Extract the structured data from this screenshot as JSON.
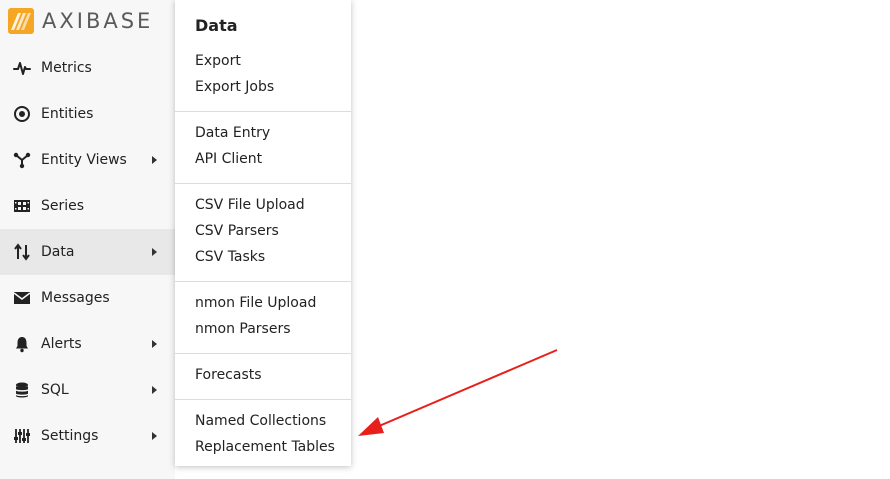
{
  "app": {
    "brand": "AXIBASE",
    "brand_colors": [
      "#f5a623",
      "#e8771e"
    ]
  },
  "sidebar": {
    "items": [
      {
        "label": "Metrics",
        "icon": "pulse-icon",
        "has_submenu": false
      },
      {
        "label": "Entities",
        "icon": "target-icon",
        "has_submenu": false
      },
      {
        "label": "Entity Views",
        "icon": "share-nodes-icon",
        "has_submenu": true
      },
      {
        "label": "Series",
        "icon": "film-strip-icon",
        "has_submenu": false
      },
      {
        "label": "Data",
        "icon": "sort-arrows-icon",
        "has_submenu": true,
        "active": true
      },
      {
        "label": "Messages",
        "icon": "envelope-icon",
        "has_submenu": false
      },
      {
        "label": "Alerts",
        "icon": "bell-icon",
        "has_submenu": true
      },
      {
        "label": "SQL",
        "icon": "database-icon",
        "has_submenu": true
      },
      {
        "label": "Settings",
        "icon": "sliders-icon",
        "has_submenu": true
      }
    ]
  },
  "menu": {
    "title": "Data",
    "groups": [
      [
        "Export",
        "Export Jobs"
      ],
      [
        "Data Entry",
        "API Client"
      ],
      [
        "CSV File Upload",
        "CSV Parsers",
        "CSV Tasks"
      ],
      [
        "nmon File Upload",
        "nmon Parsers"
      ],
      [
        "Forecasts"
      ],
      [
        "Named Collections",
        "Replacement Tables"
      ]
    ]
  },
  "annotation": {
    "arrow_color": "#e8201c",
    "arrow_target": "Replacement Tables"
  }
}
